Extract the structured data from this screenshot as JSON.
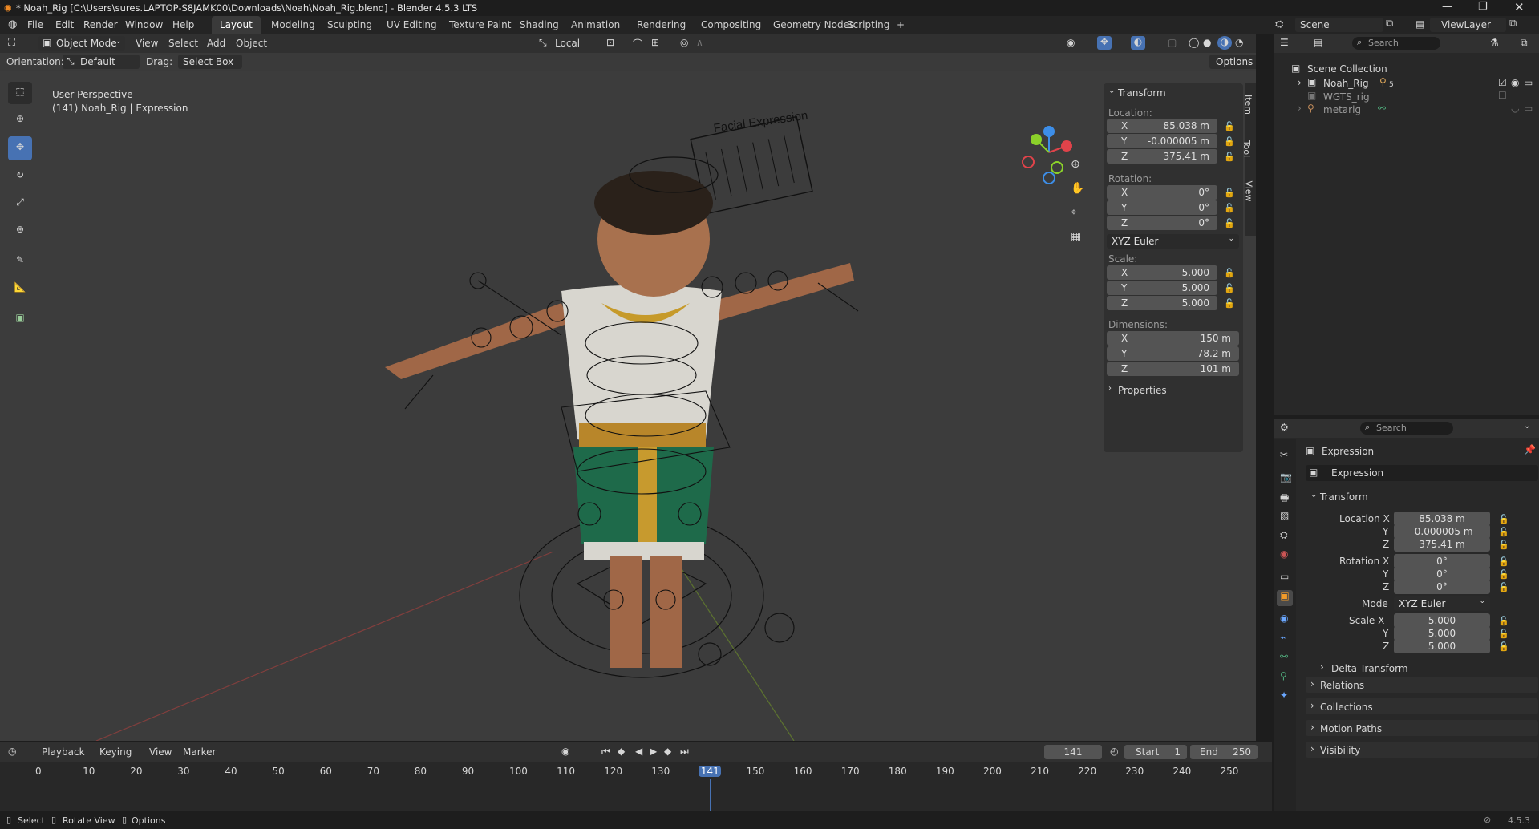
{
  "titlebar": {
    "title": "* Noah_Rig [C:\\Users\\sures.LAPTOP-S8JAMK00\\Downloads\\Noah\\Noah_Rig.blend] - Blender 4.5.3 LTS",
    "controls": [
      "minimize-icon",
      "maximize-icon",
      "close-icon"
    ]
  },
  "menubar": {
    "items": [
      "File",
      "Edit",
      "Render",
      "Window",
      "Help"
    ],
    "workspaces": [
      "Layout",
      "Modeling",
      "Sculpting",
      "UV Editing",
      "Texture Paint",
      "Shading",
      "Animation",
      "Rendering",
      "Compositing",
      "Geometry Nodes",
      "Scripting"
    ],
    "active_workspace": "Layout",
    "add_tab": "+",
    "scene_label": "Scene",
    "viewlayer_label": "ViewLayer"
  },
  "viewport_header": {
    "mode": "Object Mode",
    "menus": [
      "View",
      "Select",
      "Add",
      "Object"
    ],
    "transform_orientation": "Local",
    "orientation_label": "Orientation:",
    "orientation_value": "Default",
    "drag_label": "Drag:",
    "drag_value": "Select Box",
    "options_label": "Options"
  },
  "viewport": {
    "perspective": "User Perspective",
    "context": "(141) Noah_Rig | Expression",
    "board_title": "Facial Expression"
  },
  "n_panel": {
    "tabs": [
      "Item",
      "Tool",
      "View"
    ],
    "transform_title": "Transform",
    "location_label": "Location:",
    "location": [
      {
        "axis": "X",
        "value": "85.038 m"
      },
      {
        "axis": "Y",
        "value": "-0.000005 m"
      },
      {
        "axis": "Z",
        "value": "375.41 m"
      }
    ],
    "rotation_label": "Rotation:",
    "rotation": [
      {
        "axis": "X",
        "value": "0°"
      },
      {
        "axis": "Y",
        "value": "0°"
      },
      {
        "axis": "Z",
        "value": "0°"
      }
    ],
    "rotation_mode": "XYZ Euler",
    "scale_label": "Scale:",
    "scale": [
      {
        "axis": "X",
        "value": "5.000"
      },
      {
        "axis": "Y",
        "value": "5.000"
      },
      {
        "axis": "Z",
        "value": "5.000"
      }
    ],
    "dimensions_label": "Dimensions:",
    "dimensions": [
      {
        "axis": "X",
        "value": "150 m"
      },
      {
        "axis": "Y",
        "value": "78.2 m"
      },
      {
        "axis": "Z",
        "value": "101 m"
      }
    ],
    "properties_label": "Properties"
  },
  "outliner": {
    "search_placeholder": "Search",
    "root": "Scene Collection",
    "items": [
      {
        "name": "Noah_Rig",
        "badge": "5"
      },
      {
        "name": "WGTS_rig",
        "badge": ""
      },
      {
        "name": "metarig",
        "badge": ""
      }
    ]
  },
  "properties": {
    "search_placeholder": "Search",
    "object_name": "Expression",
    "datablock_name": "Expression",
    "transform_title": "Transform",
    "location_label": "Location X",
    "location": [
      "85.038 m",
      "-0.000005 m",
      "375.41 m"
    ],
    "rotation_label": "Rotation X",
    "rotation": [
      "0°",
      "0°",
      "0°"
    ],
    "mode_label": "Mode",
    "mode_value": "XYZ Euler",
    "scale_label": "Scale X",
    "scale": [
      "5.000",
      "5.000",
      "5.000"
    ],
    "axis_y": "Y",
    "axis_z": "Z",
    "sections": [
      "Delta Transform",
      "Relations",
      "Collections",
      "Motion Paths",
      "Visibility"
    ]
  },
  "timeline": {
    "menus": [
      "Playback",
      "Keying",
      "View",
      "Marker"
    ],
    "current_frame": "141",
    "start_label": "Start",
    "start_value": "1",
    "end_label": "End",
    "end_value": "250",
    "ruler": [
      "0",
      "10",
      "20",
      "30",
      "40",
      "50",
      "60",
      "70",
      "80",
      "90",
      "100",
      "110",
      "120",
      "130",
      "141",
      "150",
      "160",
      "170",
      "180",
      "190",
      "200",
      "210",
      "220",
      "230",
      "240",
      "250"
    ]
  },
  "statusbar": {
    "select": "Select",
    "rotate": "Rotate View",
    "options": "Options",
    "version": "4.5.3"
  },
  "colors": {
    "accent": "#4772b3",
    "axis_x": "#e0434a",
    "axis_y": "#8bd12a",
    "axis_z": "#3d8ee8",
    "frame_marker": "#4772b3"
  }
}
